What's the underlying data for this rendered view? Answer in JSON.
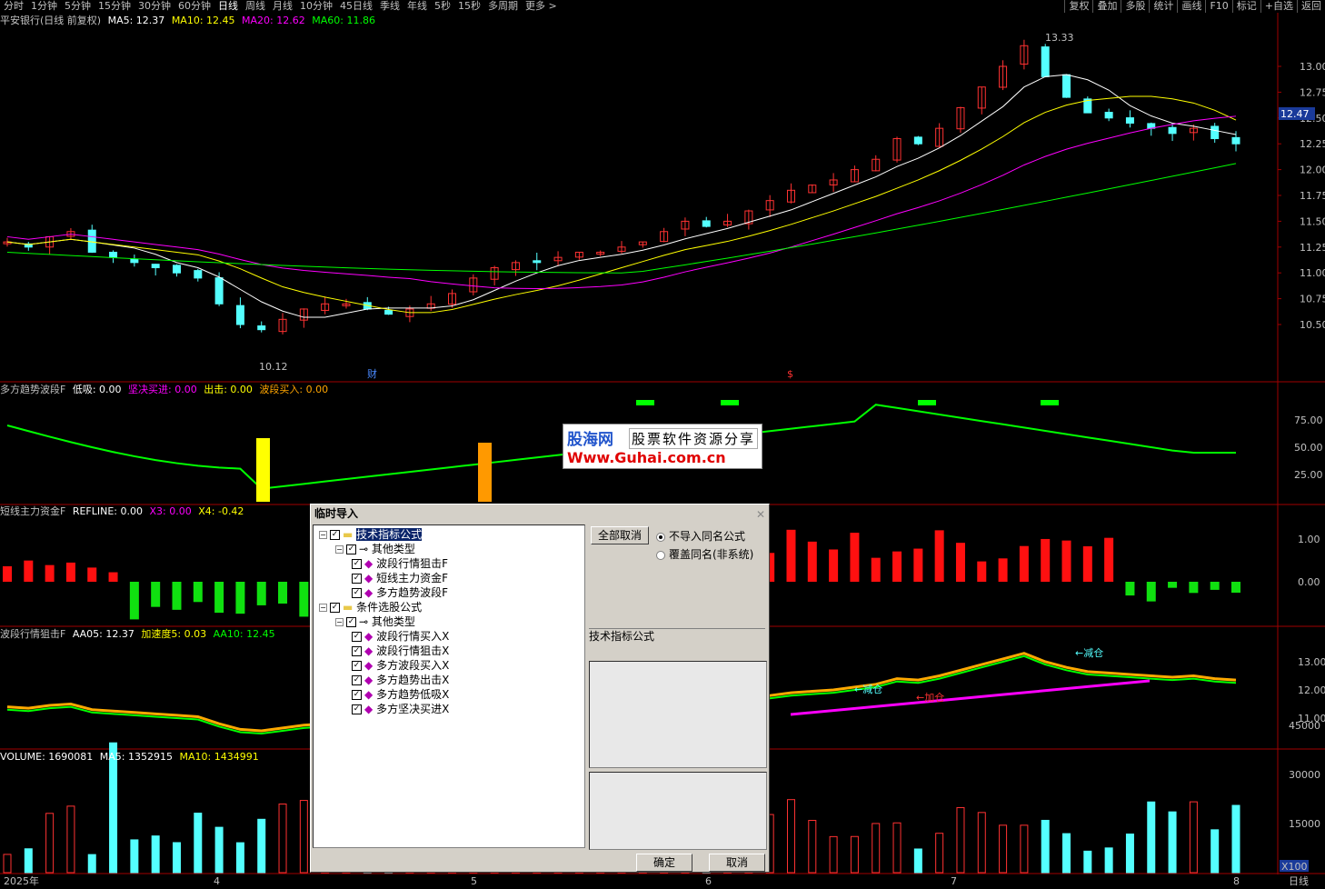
{
  "toolbar": {
    "periods": [
      "分时",
      "1分钟",
      "5分钟",
      "15分钟",
      "30分钟",
      "60分钟",
      "日线",
      "周线",
      "月线",
      "10分钟",
      "45日线",
      "季线",
      "年线",
      "5秒",
      "15秒",
      "多周期",
      "更多 >"
    ],
    "active_period": "日线",
    "right": [
      "复权",
      "叠加",
      "多股",
      "统计",
      "画线",
      "F10",
      "标记",
      "+自选",
      "返回"
    ]
  },
  "main_panel": {
    "title": "平安银行(日线 前复权)",
    "ma5": "MA5: 12.37",
    "ma10": "MA10: 12.45",
    "ma20": "MA20: 12.62",
    "ma60": "MA60: 11.86",
    "high_label": "13.33",
    "low_label": "10.12",
    "current_price": "12.47",
    "y_ticks": [
      "13.00",
      "12.75",
      "12.50",
      "12.25",
      "12.00",
      "11.75",
      "11.50",
      "11.25",
      "11.00",
      "10.75",
      "10.50"
    ],
    "markers": [
      "财",
      "$"
    ]
  },
  "ind1": {
    "title": "多方趋势波段F",
    "v1": "低吸: 0.00",
    "v2": "坚决买进: 0.00",
    "v3": "出击: 0.00",
    "v4": "波段买入: 0.00",
    "y_ticks": [
      "75.00",
      "50.00",
      "25.00"
    ]
  },
  "ind2": {
    "title": "短线主力资金F",
    "v1": "REFLINE: 0.00",
    "v2": "X3: 0.00",
    "v3": "X4: -0.42",
    "y_ticks": [
      "1.00",
      "0.00"
    ]
  },
  "ind3": {
    "title": "波段行情狙击F",
    "v1": "AA05: 12.37",
    "v2": "加速度5: 0.03",
    "v3": "AA10: 12.45",
    "v4": "12",
    "y_ticks": [
      "13.00",
      "12.00",
      "11.00"
    ],
    "labels": [
      "减仓",
      "减仓",
      "加仓"
    ]
  },
  "ind4": {
    "title": "VOLUME: 1690081",
    "v1": "MA5: 1352915",
    "v2": "MA10: 1434991",
    "y_ticks": [
      "45000",
      "30000",
      "15000"
    ],
    "unit": "X100"
  },
  "bottom": {
    "dates": [
      "2025年",
      "4",
      "5",
      "6",
      "7",
      "8"
    ],
    "period": "日线"
  },
  "watermark": {
    "brand": "股海网",
    "slogan": "股票软件资源分享",
    "url": "Www.Guhai.com.cn"
  },
  "dialog": {
    "title": "临时导入",
    "tree": [
      {
        "label": "技术指标公式",
        "level": 0,
        "selected": true
      },
      {
        "label": "其他类型",
        "level": 1
      },
      {
        "label": "波段行情狙击F",
        "level": 2
      },
      {
        "label": "短线主力资金F",
        "level": 2
      },
      {
        "label": "多方趋势波段F",
        "level": 2
      },
      {
        "label": "条件选股公式",
        "level": 0
      },
      {
        "label": "其他类型",
        "level": 1
      },
      {
        "label": "波段行情买入X",
        "level": 2
      },
      {
        "label": "波段行情狙击X",
        "level": 2
      },
      {
        "label": "多方波段买入X",
        "level": 2
      },
      {
        "label": "多方趋势出击X",
        "level": 2
      },
      {
        "label": "多方趋势低吸X",
        "level": 2
      },
      {
        "label": "多方坚决买进X",
        "level": 2
      }
    ],
    "cancel_all": "全部取消",
    "radio1": "不导入同名公式",
    "radio2": "覆盖同名(非系统)",
    "info_label": "技术指标公式",
    "ok": "确定",
    "cancel": "取消"
  },
  "colors": {
    "up": "#ff3232",
    "down": "#54ffff",
    "ma5": "#ffffff",
    "ma10": "#ffff00",
    "ma20": "#ff00ff",
    "ma60": "#00ff00"
  }
}
